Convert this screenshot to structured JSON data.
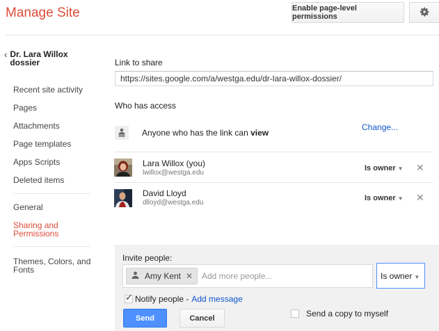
{
  "header": {
    "title": "Manage Site",
    "permissions_button": "Enable page-level permissions",
    "settings_icon": "gear-icon"
  },
  "sidebar": {
    "back_label": "Dr. Lara Willox dossier",
    "items": [
      {
        "label": "Recent site activity"
      },
      {
        "label": "Pages"
      },
      {
        "label": "Attachments"
      },
      {
        "label": "Page templates"
      },
      {
        "label": "Apps Scripts"
      },
      {
        "label": "Deleted items"
      },
      {
        "label": "General"
      },
      {
        "label": "Sharing and Permissions",
        "active": true
      },
      {
        "label": "Themes, Colors, and Fonts"
      }
    ]
  },
  "sharing": {
    "link_label": "Link to share",
    "link_value": "https://sites.google.com/a/westga.edu/dr-lara-willox-dossier/",
    "access_label": "Who has access",
    "anyone": {
      "text_prefix": "Anyone who has the link can",
      "permission": "view",
      "change_link": "Change..."
    },
    "people": [
      {
        "name": "Lara Willox (you)",
        "email": "lwillox@westga.edu",
        "role": "Is owner"
      },
      {
        "name": "David Lloyd",
        "email": "dlloyd@westga.edu",
        "role": "Is owner"
      }
    ]
  },
  "invite": {
    "label": "Invite people:",
    "chip_name": "Amy Kent",
    "placeholder": "Add more people...",
    "role": "Is owner",
    "notify_label": "Notify people -",
    "notify_checked": true,
    "add_message": "Add message",
    "copy_label": "Send a copy to myself",
    "copy_checked": false,
    "send_button": "Send",
    "cancel_button": "Cancel"
  },
  "colors": {
    "accent": "#dd4b39",
    "link": "#1155cc",
    "primary_button": "#4d90fe"
  }
}
